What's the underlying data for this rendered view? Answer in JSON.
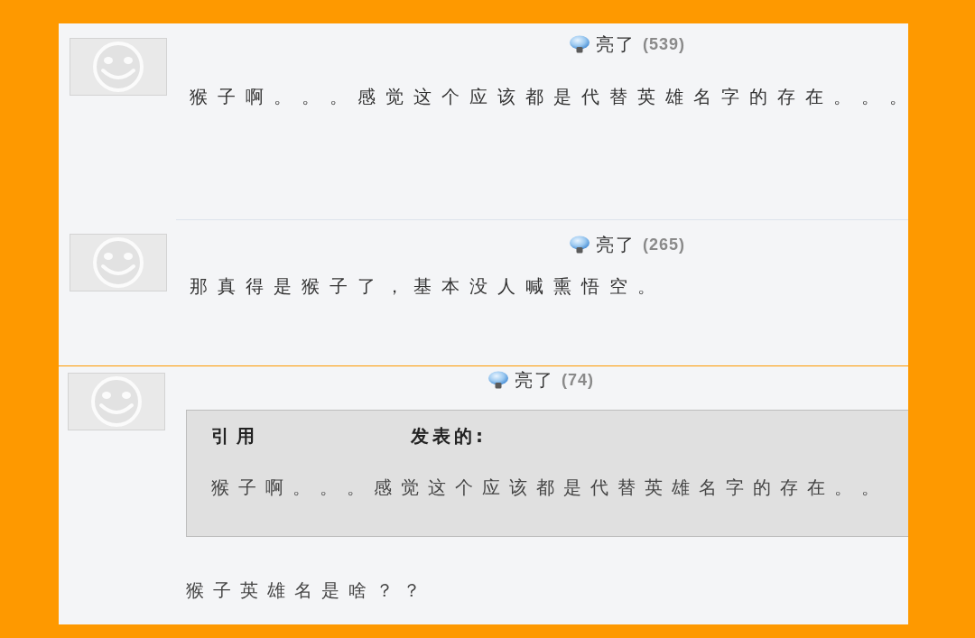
{
  "panels": [
    {
      "posts": [
        {
          "like_label": "亮了",
          "like_count": "(539)",
          "text": "猴子啊。。。感觉这个应该都是代替英雄名字的存在。。。"
        },
        {
          "like_label": "亮了",
          "like_count": "(265)",
          "text": "那真得是猴子了，基本没人喊熏悟空。"
        }
      ]
    },
    {
      "posts": [
        {
          "like_label": "亮了",
          "like_count": "(74)",
          "quote": {
            "label": "引用",
            "suffix": "发表的:",
            "text": "猴子啊。。。感觉这个应该都是代替英雄名字的存在。。"
          },
          "text": "猴子英雄名是啥？？"
        }
      ]
    }
  ]
}
